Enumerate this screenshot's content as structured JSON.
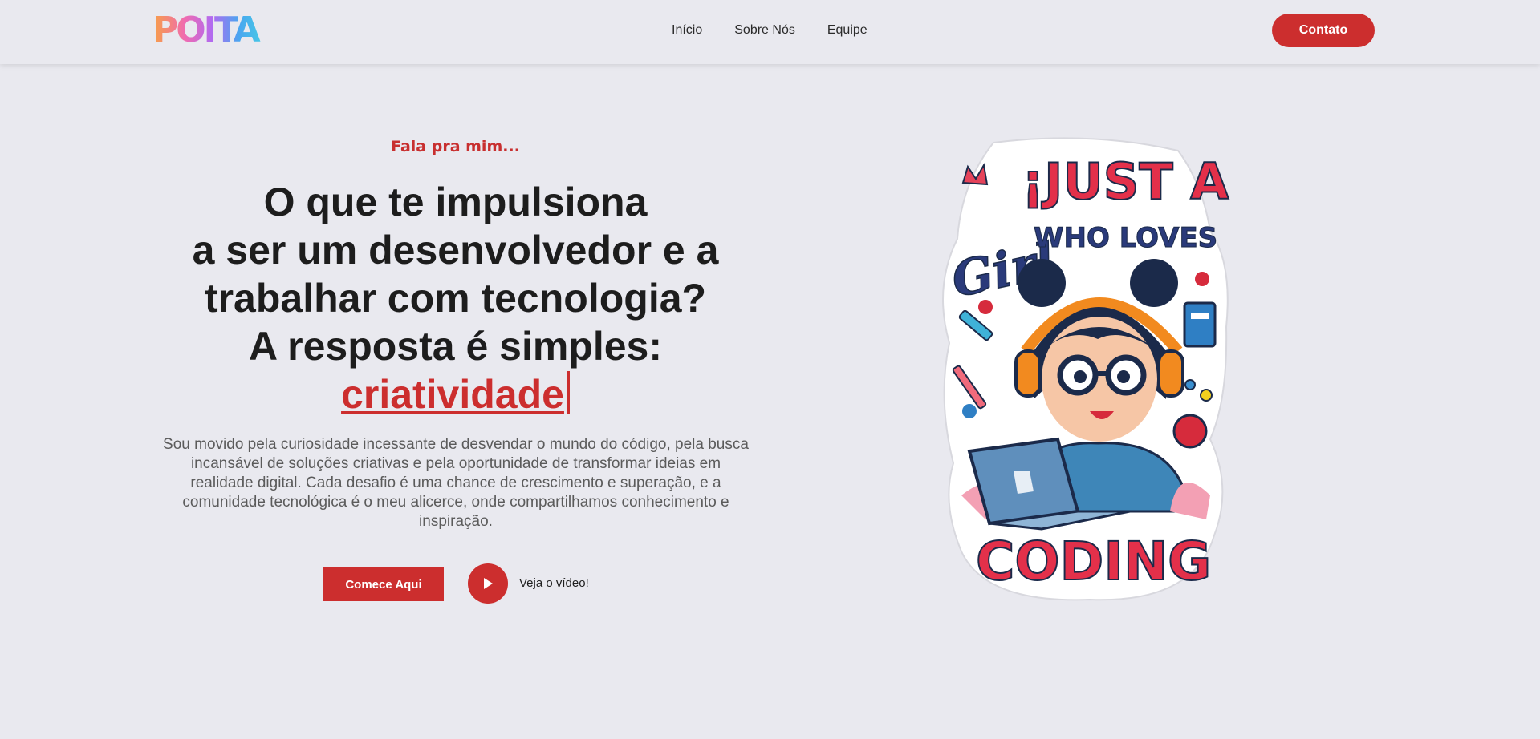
{
  "header": {
    "logo_text": "POITA",
    "nav": [
      "Início",
      "Sobre Nós",
      "Equipe"
    ],
    "contact_label": "Contato"
  },
  "hero": {
    "eyebrow": "Fala pra mim...",
    "headline_lines": [
      "O que te impulsiona",
      "a ser um desenvolvedor e a",
      "trabalhar com tecnologia?",
      "A resposta é simples:"
    ],
    "highlight_word": "criatividade",
    "description": "Sou movido pela curiosidade incessante de desvendar o mundo do código, pela busca incansável de soluções criativas e pela oportunidade de transformar ideias em realidade digital. Cada desafio é uma chance de crescimento e superação, e a comunidade tecnológica é o meu alicerce, onde compartilhamos conhecimento e inspiração.",
    "start_label": "Comece Aqui",
    "video_label": "Veja o vídeo!"
  },
  "illustration": {
    "line1": "¡JUST A",
    "line2": "Girl",
    "line3": "WHO LOVES",
    "line4": "CODING"
  },
  "colors": {
    "accent": "#cc2e2e",
    "background": "#e9e9ef",
    "text": "#1d1d1d",
    "muted": "#5b5b5b"
  },
  "icons": [
    "play-icon"
  ]
}
